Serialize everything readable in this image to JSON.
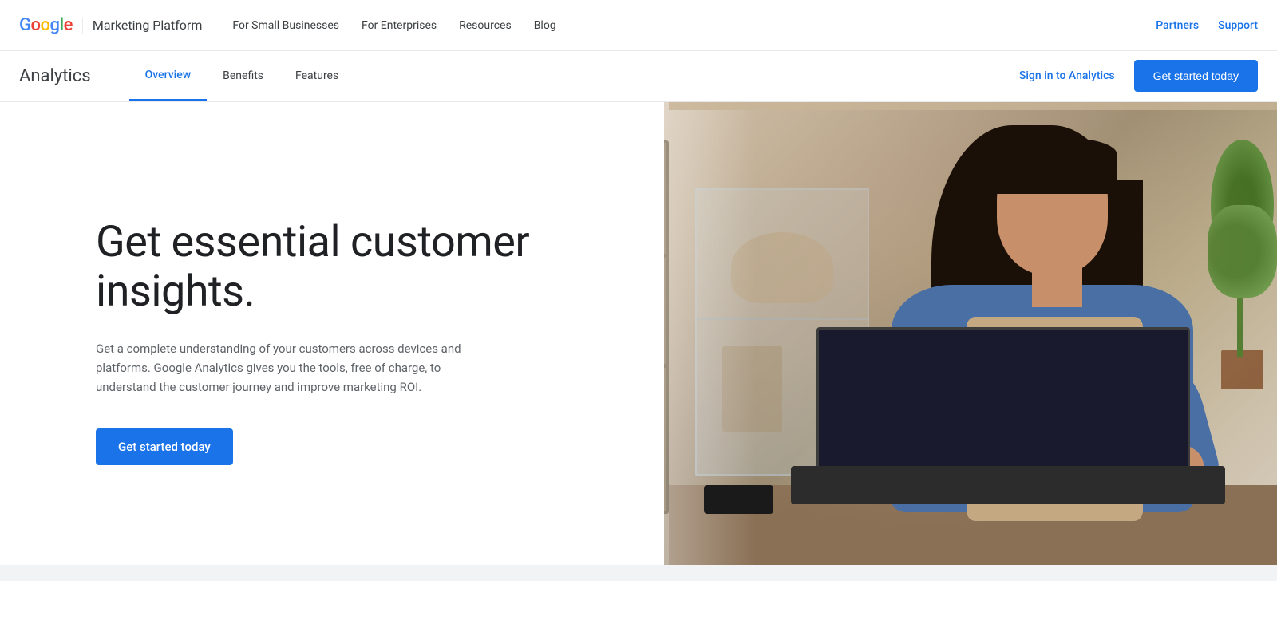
{
  "topNav": {
    "logoText": "Google",
    "productName": "Marketing Platform",
    "links": [
      {
        "label": "For Small Businesses",
        "id": "small-businesses"
      },
      {
        "label": "For Enterprises",
        "id": "enterprises"
      },
      {
        "label": "Resources",
        "id": "resources"
      },
      {
        "label": "Blog",
        "id": "blog"
      }
    ],
    "rightLinks": [
      {
        "label": "Partners",
        "id": "partners"
      },
      {
        "label": "Support",
        "id": "support"
      }
    ]
  },
  "secondaryNav": {
    "title": "Analytics",
    "tabs": [
      {
        "label": "Overview",
        "id": "overview",
        "active": true
      },
      {
        "label": "Benefits",
        "id": "benefits",
        "active": false
      },
      {
        "label": "Features",
        "id": "features",
        "active": false
      }
    ],
    "signInLabel": "Sign in to Analytics",
    "ctaLabel": "Get started today"
  },
  "hero": {
    "headline": "Get essential customer insights.",
    "body": "Get a complete understanding of your customers across devices and platforms. Google Analytics gives you the tools, free of charge, to understand the customer journey and improve marketing ROI.",
    "ctaLabel": "Get started today"
  }
}
